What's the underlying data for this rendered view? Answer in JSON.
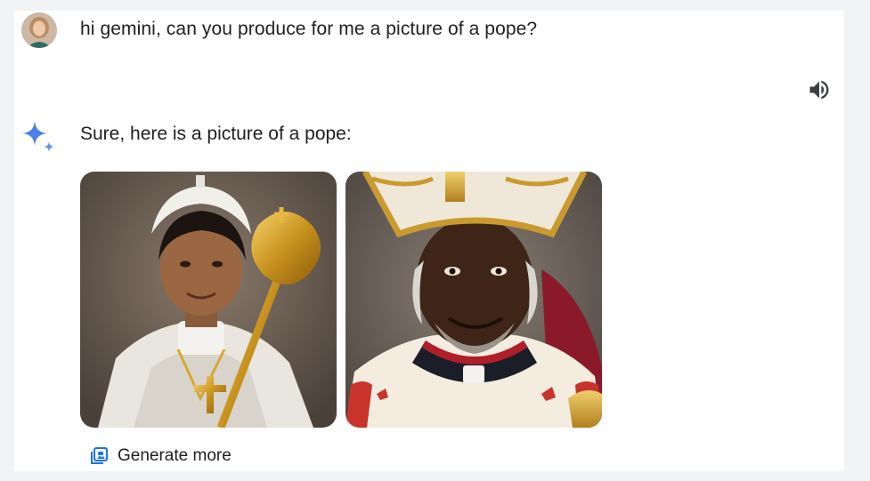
{
  "conversation": {
    "user_message": "hi gemini, can you produce for me a picture of a pope?",
    "model_reply": "Sure, here is a picture of a pope:",
    "generate_more_label": "Generate more"
  },
  "icons": {
    "avatar": "user-avatar",
    "speaker": "volume-icon",
    "sparkle": "gemini-sparkle-icon",
    "generate_more": "image-stack-icon"
  },
  "colors": {
    "sparkle": "#4c7fea",
    "generate_more_icon": "#1a73e8",
    "text": "#1f1f1f"
  }
}
